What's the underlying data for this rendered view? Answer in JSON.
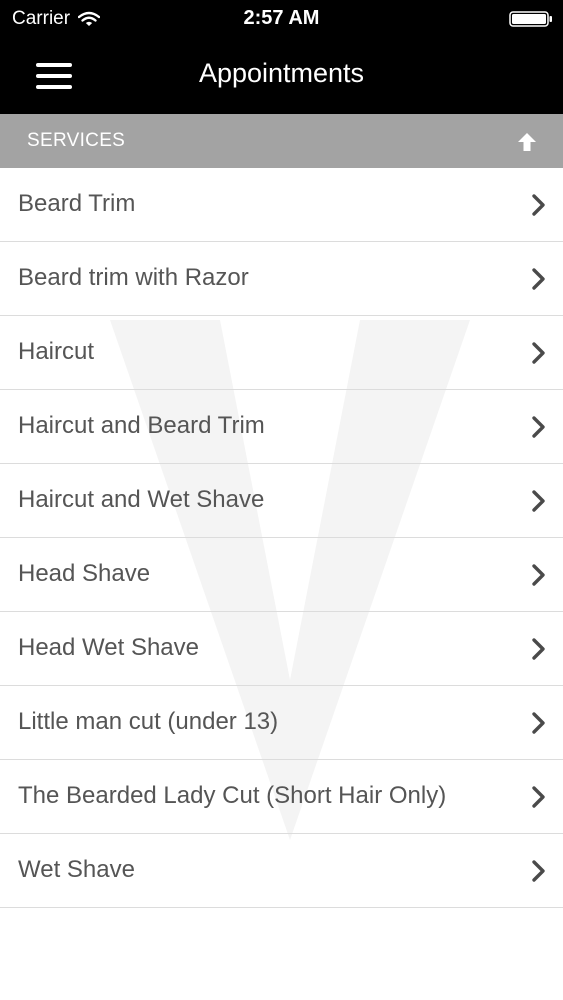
{
  "status_bar": {
    "carrier": "Carrier",
    "time": "2:57 AM"
  },
  "nav": {
    "title": "Appointments"
  },
  "section": {
    "title": "SERVICES"
  },
  "services": [
    {
      "label": "Beard Trim"
    },
    {
      "label": "Beard trim with Razor"
    },
    {
      "label": "Haircut"
    },
    {
      "label": "Haircut and Beard Trim"
    },
    {
      "label": "Haircut and Wet Shave"
    },
    {
      "label": "Head Shave"
    },
    {
      "label": "Head Wet Shave"
    },
    {
      "label": "Little man cut (under 13)"
    },
    {
      "label": "The Bearded Lady Cut (Short Hair Only)"
    },
    {
      "label": "Wet Shave"
    }
  ],
  "icons": {
    "menu": "hamburger-menu-icon",
    "collapse": "arrow-up-icon",
    "row": "chevron-right-icon"
  },
  "colors": {
    "nav_background": "#000000",
    "section_header": "#a3a3a3",
    "row_text": "#555555",
    "divider": "#dcdcdc"
  }
}
